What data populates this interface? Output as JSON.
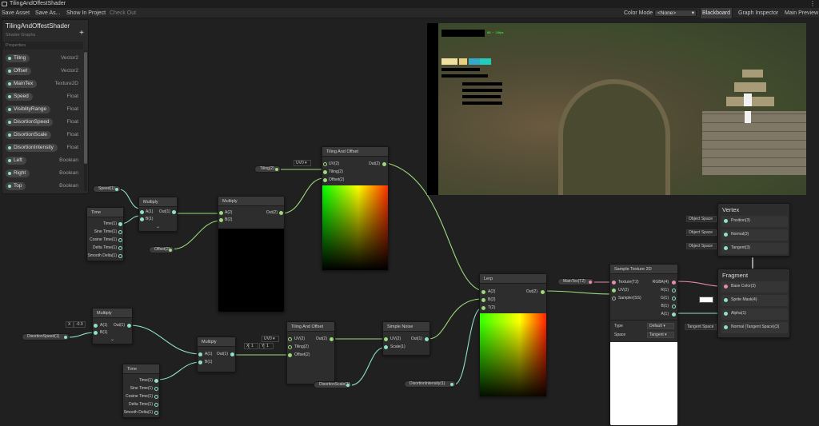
{
  "window": {
    "title": "TilingAndOffestShader"
  },
  "toolbar": {
    "save_asset": "Save Asset",
    "save_as": "Save As...",
    "show_in_project": "Show In Project",
    "check_out": "Check Out",
    "color_mode_label": "Color Mode",
    "color_mode_value": "<None>",
    "blackboard": "Blackboard",
    "graph_inspector": "Graph Inspector",
    "main_preview": "Main Preview"
  },
  "blackboard": {
    "title": "TilingAndOffestShader",
    "subtitle": "Shader Graphs",
    "section": "Properties",
    "add_icon": "plus-icon",
    "properties": [
      {
        "name": "Tiling",
        "type": "Vector2"
      },
      {
        "name": "Offset",
        "type": "Vector2"
      },
      {
        "name": "MainTex",
        "type": "Texture2D"
      },
      {
        "name": "Speed",
        "type": "Float"
      },
      {
        "name": "VisiblityRange",
        "type": "Float"
      },
      {
        "name": "DisortionSpeed",
        "type": "Float"
      },
      {
        "name": "DisortionScale",
        "type": "Float"
      },
      {
        "name": "DisortionIntensity",
        "type": "Float"
      },
      {
        "name": "Left",
        "type": "Boolean"
      },
      {
        "name": "Right",
        "type": "Boolean"
      },
      {
        "name": "Top",
        "type": "Boolean"
      }
    ]
  },
  "nodes": {
    "time1": {
      "title": "Time",
      "outs": [
        "Time(1)",
        "Sine Time(1)",
        "Cosine Time(1)",
        "Delta Time(1)",
        "Smooth Delta(1)"
      ]
    },
    "time2": {
      "title": "Time",
      "outs": [
        "Time(1)",
        "Sine Time(1)",
        "Cosine Time(1)",
        "Delta Time(1)",
        "Smooth Delta(1)"
      ]
    },
    "mult1": {
      "title": "Multiply",
      "a": "A(1)",
      "b": "B(1)",
      "out": "Out(1)"
    },
    "mult2": {
      "title": "Multiply",
      "a": "A(2)",
      "b": "B(2)",
      "out": "Out(2)"
    },
    "mult3": {
      "title": "Multiply",
      "a": "A(1)",
      "b": "B(1)",
      "out": "Out(1)",
      "x_label": "X",
      "x_value": "-0.9"
    },
    "mult4": {
      "title": "Multiply",
      "a": "A(1)",
      "b": "B(1)",
      "out": "Out(1)"
    },
    "tiling1": {
      "title": "Tiling And Offset",
      "uv": "UV(2)",
      "tiling": "Tiling(2)",
      "offset": "Offset(2)",
      "out": "Out(2)",
      "uv_select": "UV0"
    },
    "tiling2": {
      "title": "Tiling And Offset",
      "uv": "UV(2)",
      "tiling": "Tiling(2)",
      "offset": "Offset(2)",
      "out": "Out(2)",
      "uv_select": "UV0",
      "x_label": "X",
      "x_value": "1",
      "y_label": "Y",
      "y_value": "1"
    },
    "noise": {
      "title": "Simple Noise",
      "uv": "UV(2)",
      "scale": "Scale(1)",
      "out": "Out(1)"
    },
    "lerp": {
      "title": "Lerp",
      "a": "A(2)",
      "b": "B(2)",
      "t": "T(2)",
      "out": "Out(2)"
    },
    "sample": {
      "title": "Sample Texture 2D",
      "tex": "Texture(T2)",
      "uv": "UV(2)",
      "sampler": "Sampler(SS)",
      "rgba": "RGBA(4)",
      "r": "R(1)",
      "g": "G(1)",
      "b": "B(1)",
      "a": "A(1)",
      "type_label": "Type",
      "type_value": "Default",
      "space_label": "Space",
      "space_value": "Tangent"
    },
    "vertex": {
      "title": "Vertex",
      "pos": "Position(3)",
      "normal": "Normal(3)",
      "tangent": "Tangent(3)"
    },
    "fragment": {
      "title": "Fragment",
      "base": "Base Color(3)",
      "mask": "Sprite Mask(4)",
      "alpha": "Alpha(1)",
      "normal": "Normal (Tangent Space)(3)"
    }
  },
  "pills": {
    "speed": "Speed(1)",
    "tiling": "Tiling(2)",
    "offset": "Offset(2)",
    "dspeed": "DisortionSpeed(1)",
    "dscale": "DisortionScale(1)",
    "dintensity": "DisortionIntensity(1)",
    "maintex": "MainTex(T2)"
  },
  "space_labels": {
    "obj1": "Object Space",
    "obj2": "Object Space",
    "obj3": "Object Space",
    "tangent": "Tangent Space"
  },
  "colors": {
    "float_wire": "#8fe0c8",
    "vector_wire": "#9cd97a",
    "texture_port": "#e78ca8"
  }
}
